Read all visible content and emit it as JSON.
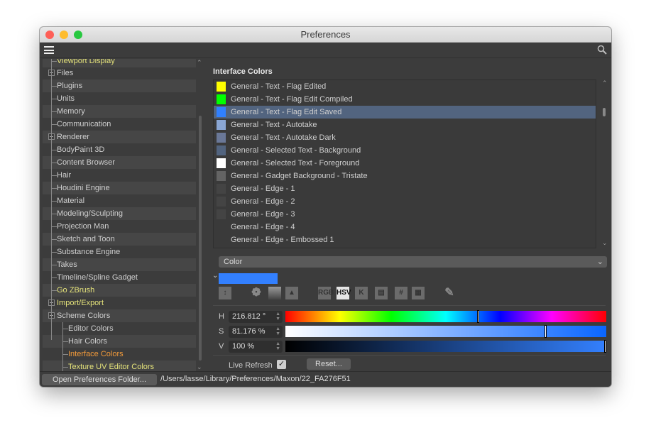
{
  "window": {
    "title": "Preferences"
  },
  "tree": {
    "items": [
      {
        "label": "Viewport Display",
        "level": 0,
        "color": "yellow",
        "cut": true
      },
      {
        "label": "Files",
        "level": 0,
        "expander": "plus"
      },
      {
        "label": "Plugins",
        "level": 0
      },
      {
        "label": "Units",
        "level": 0
      },
      {
        "label": "Memory",
        "level": 0
      },
      {
        "label": "Communication",
        "level": 0
      },
      {
        "label": "Renderer",
        "level": 0,
        "expander": "plus"
      },
      {
        "label": "BodyPaint 3D",
        "level": 0
      },
      {
        "label": "Content Browser",
        "level": 0
      },
      {
        "label": "Hair",
        "level": 0
      },
      {
        "label": "Houdini Engine",
        "level": 0
      },
      {
        "label": "Material",
        "level": 0
      },
      {
        "label": "Modeling/Sculpting",
        "level": 0
      },
      {
        "label": "Projection Man",
        "level": 0
      },
      {
        "label": "Sketch and Toon",
        "level": 0
      },
      {
        "label": "Substance Engine",
        "level": 0
      },
      {
        "label": "Takes",
        "level": 0
      },
      {
        "label": "Timeline/Spline Gadget",
        "level": 0
      },
      {
        "label": "Go ZBrush",
        "level": 0,
        "color": "yellow"
      },
      {
        "label": "Import/Export",
        "level": 0,
        "color": "yellow",
        "expander": "plus"
      },
      {
        "label": "Scheme Colors",
        "level": 0,
        "expander": "minus"
      },
      {
        "label": "Editor Colors",
        "level": 1
      },
      {
        "label": "Hair Colors",
        "level": 1
      },
      {
        "label": "Interface Colors",
        "level": 1,
        "color": "orange",
        "selected": true
      },
      {
        "label": "Texture UV Editor Colors",
        "level": 1,
        "color": "yellow"
      }
    ]
  },
  "panel": {
    "title": "Interface Colors",
    "colors": [
      {
        "label": "General - Text - Flag Edited",
        "swatch": "#ffff00"
      },
      {
        "label": "General - Text - Flag Edit Compiled",
        "swatch": "#00ff00"
      },
      {
        "label": "General - Text - Flag Edit Saved",
        "swatch": "#3080ff",
        "selected": true
      },
      {
        "label": "General - Text - Autotake",
        "swatch": "#8aa6d4"
      },
      {
        "label": "General - Text - Autotake Dark",
        "swatch": "#6a7898"
      },
      {
        "label": "General - Selected Text - Background",
        "swatch": "#52647f"
      },
      {
        "label": "General - Selected Text - Foreground",
        "swatch": "#ffffff"
      },
      {
        "label": "General - Gadget Background - Tristate",
        "swatch": "#646464"
      },
      {
        "label": "General - Edge - 1",
        "swatch": "#444444"
      },
      {
        "label": "General - Edge - 2",
        "swatch": "#444444"
      },
      {
        "label": "General - Edge - 3",
        "swatch": "#444444"
      },
      {
        "label": "General - Edge - 4",
        "swatch": "#3a3a3a"
      },
      {
        "label": "General - Edge - Embossed 1",
        "swatch": "#3a3a3a"
      },
      {
        "label": "",
        "swatch": "#444444"
      }
    ],
    "mode_dropdown": "Color",
    "current_color": "#3380ff",
    "tools": [
      "compact-icon",
      "color-wheel-icon",
      "spectrum-icon",
      "picture-icon",
      "RGB",
      "HSV",
      "K",
      "mixer-icon",
      "#",
      "swatches-icon",
      "eyedropper-icon"
    ],
    "active_tool": "HSV",
    "h": {
      "label": "H",
      "value": "216.812 °",
      "fraction": 0.6023
    },
    "s": {
      "label": "S",
      "value": "81.176 %",
      "fraction": 0.81176
    },
    "v": {
      "label": "V",
      "value": "100 %",
      "fraction": 1.0
    },
    "live_refresh": {
      "label": "Live Refresh",
      "checked": true
    },
    "reset": "Reset..."
  },
  "footer": {
    "button": "Open Preferences Folder...",
    "path": "/Users/lasse/Library/Preferences/Maxon/22_FA276F51"
  }
}
